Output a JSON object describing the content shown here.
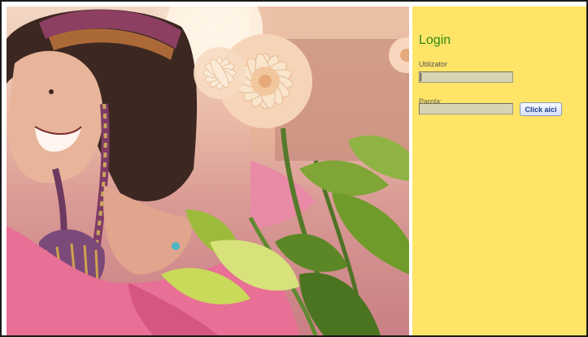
{
  "login": {
    "title": "Login",
    "username_label": "Utilizator",
    "username_value": "",
    "password_label": "Parola:",
    "password_value": "",
    "submit_label": "Click aici"
  },
  "colors": {
    "panel_background": "#ffe467",
    "title_color": "#2e8b12",
    "input_background": "#d8d3b2"
  }
}
